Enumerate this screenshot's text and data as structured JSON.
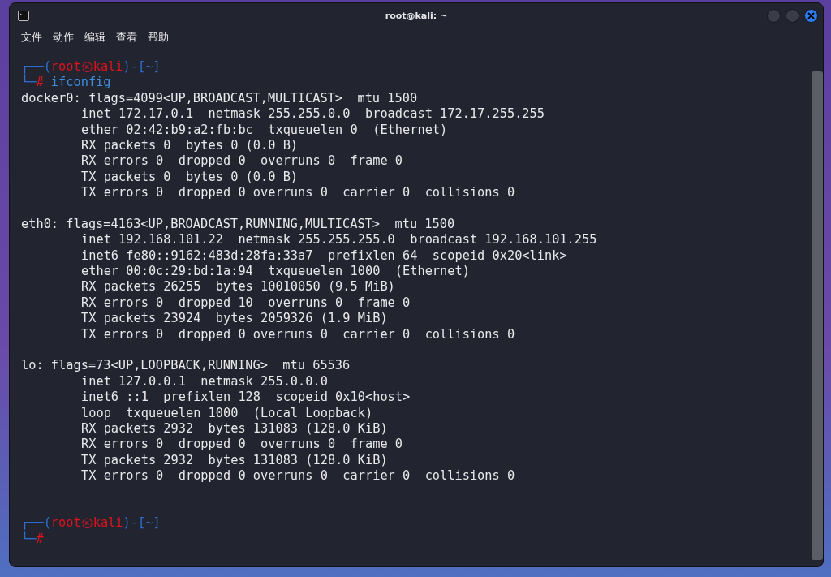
{
  "window": {
    "title": "root@kali: ~"
  },
  "menu": [
    "文件",
    "动作",
    "编辑",
    "查看",
    "帮助"
  ],
  "prompts": [
    {
      "segments": [
        {
          "text": "┌──(",
          "color": "#2f6fd6"
        },
        {
          "text": "root㉿kali",
          "color": "#e0131b"
        },
        {
          "text": ")-[",
          "color": "#2f6fd6"
        },
        {
          "text": "~",
          "color": "#2f6fd6"
        },
        {
          "text": "]",
          "color": "#2f6fd6"
        }
      ],
      "corner": "└─",
      "sign": "#",
      "command": "ifconfig"
    },
    {
      "segments": [
        {
          "text": "┌──(",
          "color": "#2f6fd6"
        },
        {
          "text": "root㉿kali",
          "color": "#e0131b"
        },
        {
          "text": ")-[",
          "color": "#2f6fd6"
        },
        {
          "text": "~",
          "color": "#2f6fd6"
        },
        {
          "text": "]",
          "color": "#2f6fd6"
        }
      ],
      "corner": "└─",
      "sign": "#",
      "cursor": true
    }
  ],
  "interfaces": [
    {
      "header": "docker0: flags=4099<UP,BROADCAST,MULTICAST>  mtu 1500",
      "details": [
        "inet 172.17.0.1  netmask 255.255.0.0  broadcast 172.17.255.255",
        "ether 02:42:b9:a2:fb:bc  txqueuelen 0  (Ethernet)",
        "RX packets 0  bytes 0 (0.0 B)",
        "RX errors 0  dropped 0  overruns 0  frame 0",
        "TX packets 0  bytes 0 (0.0 B)",
        "TX errors 0  dropped 0 overruns 0  carrier 0  collisions 0"
      ]
    },
    {
      "header": "eth0: flags=4163<UP,BROADCAST,RUNNING,MULTICAST>  mtu 1500",
      "details": [
        "inet 192.168.101.22  netmask 255.255.255.0  broadcast 192.168.101.255",
        "inet6 fe80::9162:483d:28fa:33a7  prefixlen 64  scopeid 0x20<link>",
        "ether 00:0c:29:bd:1a:94  txqueuelen 1000  (Ethernet)",
        "RX packets 26255  bytes 10010050 (9.5 MiB)",
        "RX errors 0  dropped 10  overruns 0  frame 0",
        "TX packets 23924  bytes 2059326 (1.9 MiB)",
        "TX errors 0  dropped 0 overruns 0  carrier 0  collisions 0"
      ]
    },
    {
      "header": "lo: flags=73<UP,LOOPBACK,RUNNING>  mtu 65536",
      "details": [
        "inet 127.0.0.1  netmask 255.0.0.0",
        "inet6 ::1  prefixlen 128  scopeid 0x10<host>",
        "loop  txqueuelen 1000  (Local Loopback)",
        "RX packets 2932  bytes 131083 (128.0 KiB)",
        "RX errors 0  dropped 0  overruns 0  frame 0",
        "TX packets 2932  bytes 131083 (128.0 KiB)",
        "TX errors 0  dropped 0 overruns 0  carrier 0  collisions 0"
      ]
    }
  ]
}
